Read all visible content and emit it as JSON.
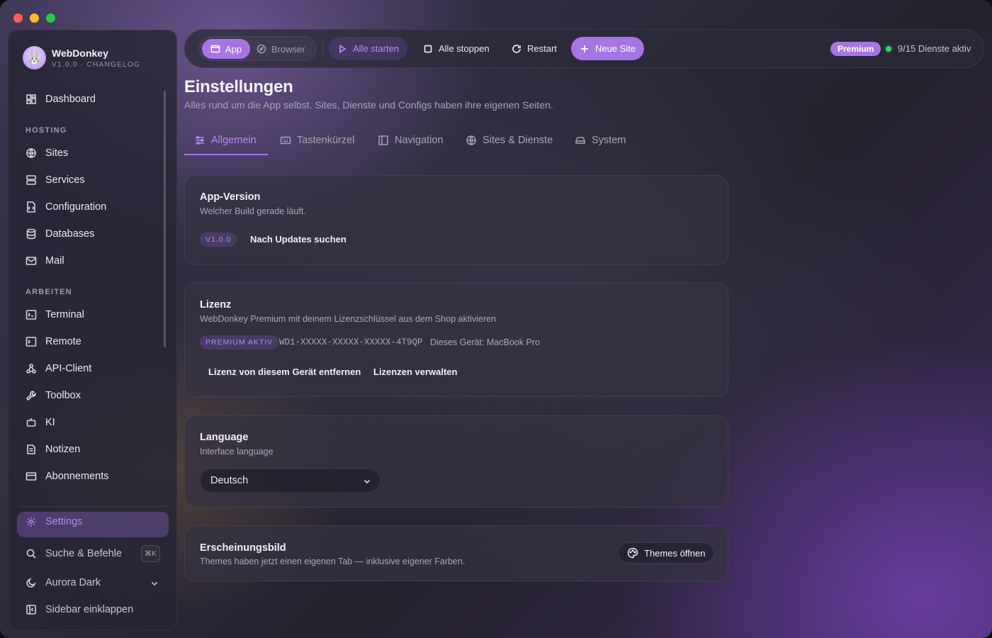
{
  "brand": {
    "name": "WebDonkey",
    "sub": "V1.0.0 · CHANGELOG"
  },
  "sidebar": {
    "dashboard": "Dashboard",
    "section_hosting": "HOSTING",
    "hosting": [
      "Sites",
      "Services",
      "Configuration",
      "Databases",
      "Mail"
    ],
    "section_arbeiten": "ARBEITEN",
    "arbeiten": [
      "Terminal",
      "Remote",
      "API-Client",
      "Toolbox",
      "KI",
      "Notizen",
      "Abonnements"
    ],
    "settings": "Settings",
    "search": "Suche & Befehle",
    "search_shortcut": "⌘K",
    "theme": "Aurora Dark",
    "collapse": "Sidebar einklappen"
  },
  "toolbar": {
    "app": "App",
    "browser": "Browser",
    "start_all": "Alle starten",
    "stop_all": "Alle stoppen",
    "restart": "Restart",
    "new_site": "Neue Site",
    "premium": "Premium",
    "status": "9/15 Dienste aktiv",
    "status_color": "#38d36a",
    "accent": "#a774e6"
  },
  "page": {
    "title": "Einstellungen",
    "subtitle": "Alles rund um die App selbst. Sites, Dienste und Configs haben ihre eigenen Seiten.",
    "tabs": [
      "Allgemein",
      "Tastenkürzel",
      "Navigation",
      "Sites & Dienste",
      "System"
    ],
    "active_tab": "Allgemein"
  },
  "cards": {
    "version": {
      "title": "App-Version",
      "sub": "Welcher Build gerade läuft.",
      "badge": "V1.0.0",
      "action": "Nach Updates suchen"
    },
    "license": {
      "title": "Lizenz",
      "sub": "WebDonkey Premium mit deinem Lizenzschlüssel aus dem Shop aktivieren",
      "badge": "PREMIUM AKTIV",
      "key": "WD1-XXXXX-XXXXX-XXXXX-4T9QP",
      "device": "Dieses Gerät: MacBook Pro",
      "remove": "Lizenz von diesem Gerät entfernen",
      "manage": "Lizenzen verwalten"
    },
    "language": {
      "title": "Language",
      "sub": "Interface language",
      "value": "Deutsch"
    },
    "appearance": {
      "title": "Erscheinungsbild",
      "sub": "Themes haben jetzt einen eigenen Tab — inklusive eigener Farben.",
      "action": "Themes öffnen"
    }
  }
}
